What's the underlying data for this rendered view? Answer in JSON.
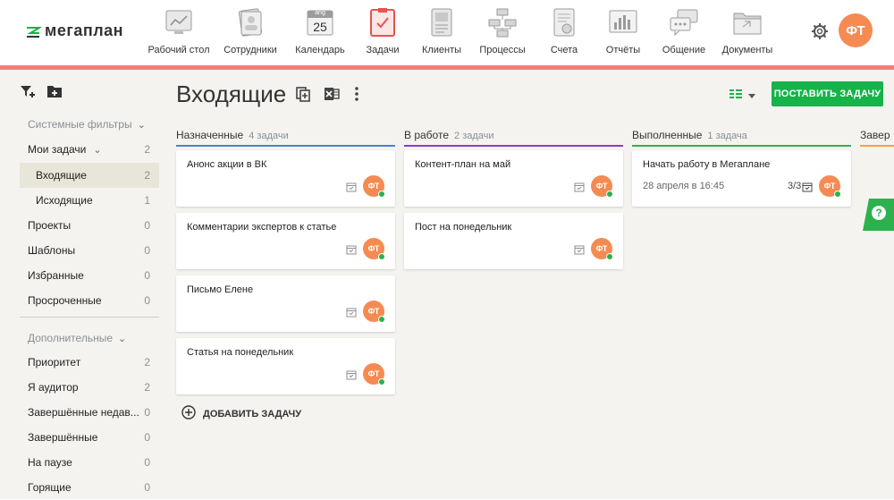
{
  "app": {
    "logo_text": "мегаплан"
  },
  "nav": {
    "items": [
      {
        "label": "Рабочий стол",
        "icon": "desktop-icon"
      },
      {
        "label": "Сотрудники",
        "icon": "employees-icon"
      },
      {
        "label": "Календарь",
        "icon": "calendar-icon",
        "badge_top": "ang",
        "badge_num": "25"
      },
      {
        "label": "Задачи",
        "icon": "tasks-icon",
        "active": true
      },
      {
        "label": "Клиенты",
        "icon": "clients-icon"
      },
      {
        "label": "Процессы",
        "icon": "processes-icon"
      },
      {
        "label": "Счета",
        "icon": "invoices-icon"
      },
      {
        "label": "Отчёты",
        "icon": "reports-icon"
      },
      {
        "label": "Общение",
        "icon": "chat-icon"
      },
      {
        "label": "Документы",
        "icon": "documents-icon"
      }
    ]
  },
  "header": {
    "avatar_initials": "ФТ"
  },
  "sidebar": {
    "system_filters_heading": "Системные фильтры",
    "my_tasks": {
      "label": "Мои задачи",
      "count": "2"
    },
    "incoming": {
      "label": "Входящие",
      "count": "2"
    },
    "outgoing": {
      "label": "Исходящие",
      "count": "1"
    },
    "projects": {
      "label": "Проекты",
      "count": "0"
    },
    "templates": {
      "label": "Шаблоны",
      "count": "0"
    },
    "favorites": {
      "label": "Избранные",
      "count": "0"
    },
    "overdue": {
      "label": "Просроченные",
      "count": "0"
    },
    "extra_heading": "Дополнительные",
    "priority": {
      "label": "Приоритет",
      "count": "2"
    },
    "auditor": {
      "label": "Я аудитор",
      "count": "2"
    },
    "recent_done": {
      "label": "Завершённые недав...",
      "count": "0"
    },
    "done": {
      "label": "Завершённые",
      "count": "0"
    },
    "paused": {
      "label": "На паузе",
      "count": "0"
    },
    "burning": {
      "label": "Горящие",
      "count": "0"
    }
  },
  "main": {
    "title": "Входящие",
    "primary_button": "ПОСТАВИТЬ ЗАДАЧУ",
    "add_task": "ДОБАВИТЬ ЗАДАЧУ"
  },
  "lanes": {
    "assigned": {
      "title": "Назначенные",
      "count": "4 задачи",
      "cards": [
        {
          "title": "Анонс акции в ВК",
          "avatar": "ФТ"
        },
        {
          "title": "Комментарии экспертов к статье",
          "avatar": "ФТ"
        },
        {
          "title": "Письмо Елене",
          "avatar": "ФТ"
        },
        {
          "title": "Статья на понедельник",
          "avatar": "ФТ"
        }
      ]
    },
    "in_progress": {
      "title": "В работе",
      "count": "2 задачи",
      "cards": [
        {
          "title": "Контент-план на май",
          "avatar": "ФТ"
        },
        {
          "title": "Пост на понедельник",
          "avatar": "ФТ"
        }
      ]
    },
    "done": {
      "title": "Выполненные",
      "count": "1 задача",
      "cards": [
        {
          "title": "Начать работу в Мегаплане",
          "date": "28 апреля в 16:45",
          "progress": "3/3",
          "avatar": "ФТ"
        }
      ]
    },
    "finished": {
      "title": "Завер"
    }
  },
  "colors": {
    "accent_red": "#f07f7b",
    "primary_green": "#16b24a",
    "avatar_orange": "#f58b52",
    "lane_blue": "#4a7fd6",
    "lane_purple": "#8a3ccf",
    "lane_green": "#31b14a",
    "lane_orange": "#f2a33a"
  }
}
